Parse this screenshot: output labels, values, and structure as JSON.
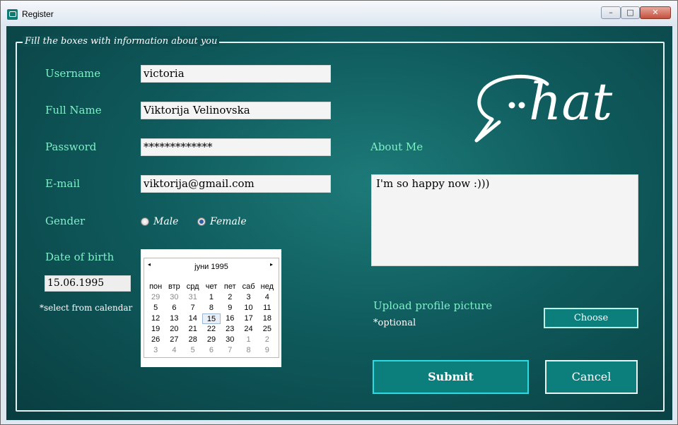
{
  "window": {
    "title": "Register",
    "controls": {
      "minimize": "–",
      "maximize": "□",
      "close": "✕"
    }
  },
  "form": {
    "group_title": "Fill the boxes with information about you",
    "username": {
      "label": "Username",
      "value": "victoria"
    },
    "full_name": {
      "label": "Full Name",
      "value": "Viktorija Velinovska"
    },
    "password": {
      "label": "Password",
      "value": "*************"
    },
    "email": {
      "label": "E-mail",
      "value": "viktorija@gmail.com"
    },
    "gender": {
      "label": "Gender",
      "options": [
        "Male",
        "Female"
      ],
      "selected": "Female"
    },
    "dob": {
      "label": "Date of birth",
      "value": "15.06.1995",
      "hint": "*select from calendar",
      "calendar": {
        "month_label": "јуни 1995",
        "prev": "◂",
        "next": "▸",
        "weekdays": [
          "пон",
          "втр",
          "срд",
          "чет",
          "пет",
          "саб",
          "нед"
        ],
        "weeks": [
          [
            "29",
            "30",
            "31",
            "1",
            "2",
            "3",
            "4"
          ],
          [
            "5",
            "6",
            "7",
            "8",
            "9",
            "10",
            "11"
          ],
          [
            "12",
            "13",
            "14",
            "15",
            "16",
            "17",
            "18"
          ],
          [
            "19",
            "20",
            "21",
            "22",
            "23",
            "24",
            "25"
          ],
          [
            "26",
            "27",
            "28",
            "29",
            "30",
            "1",
            "2"
          ],
          [
            "3",
            "4",
            "5",
            "6",
            "7",
            "8",
            "9"
          ]
        ],
        "selected_day": "15"
      }
    },
    "about": {
      "label": "About Me",
      "value": "I'm so happy now :)))"
    },
    "upload": {
      "label": "Upload profile picture",
      "note": "*optional",
      "button": "Choose"
    },
    "submit": "Submit",
    "cancel": "Cancel"
  },
  "logo": {
    "text": "hat"
  },
  "colors": {
    "accent_label": "#7ff0c8",
    "button_fill": "#0c7f7c",
    "background": "#0f5a5c"
  }
}
